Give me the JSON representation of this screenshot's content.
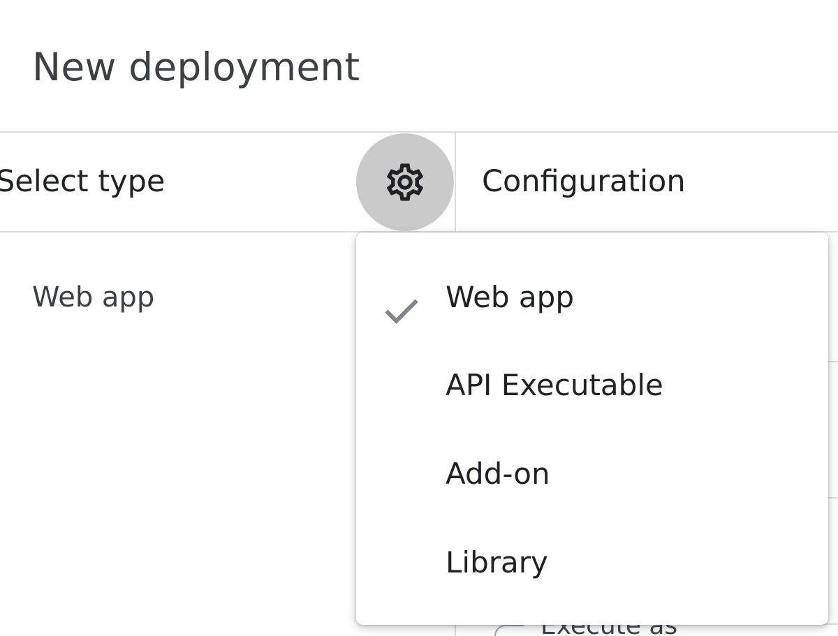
{
  "dialog": {
    "title": "New deployment"
  },
  "columns": {
    "left_header": "Select type",
    "right_header": "Configuration"
  },
  "settings_button": {
    "icon": "gear-icon"
  },
  "selected_type": "Web app",
  "type_menu": {
    "items": [
      {
        "label": "Web app",
        "checked": true
      },
      {
        "label": "API Executable",
        "checked": false
      },
      {
        "label": "Add-on",
        "checked": false
      },
      {
        "label": "Library",
        "checked": false
      }
    ]
  },
  "configuration": {
    "execute_as_label": "Execute as"
  },
  "colors": {
    "divider": "#dadce0",
    "gear_button_bg": "#cacaca",
    "check_color": "#80868b",
    "text_primary": "#202124",
    "text_secondary": "#3c4043"
  }
}
